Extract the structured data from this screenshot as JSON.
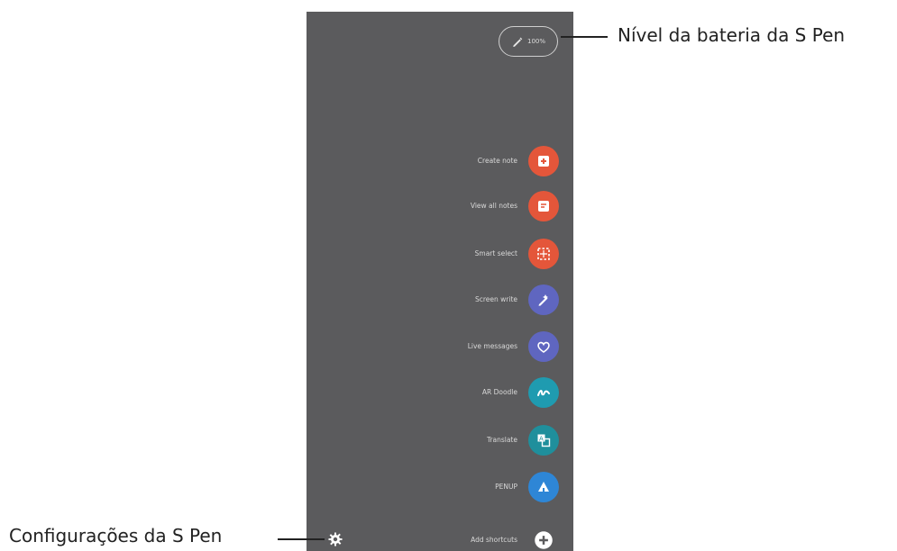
{
  "callouts": {
    "battery_label": "Nível da bateria da S Pen",
    "settings_label": "Configurações da S Pen"
  },
  "battery": {
    "level_text": "100%"
  },
  "shortcuts": [
    {
      "label": "Create note",
      "icon": "note-plus-icon",
      "color": "#e4563a"
    },
    {
      "label": "View all notes",
      "icon": "notes-icon",
      "color": "#e4563a"
    },
    {
      "label": "Smart select",
      "icon": "smart-select-icon",
      "color": "#e4563a"
    },
    {
      "label": "Screen write",
      "icon": "screen-write-icon",
      "color": "#5f66c0"
    },
    {
      "label": "Live messages",
      "icon": "heart-icon",
      "color": "#5f66c0"
    },
    {
      "label": "AR Doodle",
      "icon": "doodle-icon",
      "color": "#1f9bb0"
    },
    {
      "label": "Translate",
      "icon": "translate-icon",
      "color": "#1f8f9c"
    },
    {
      "label": "PENUP",
      "icon": "penup-icon",
      "color": "#2e86d6"
    },
    {
      "label": "Add shortcuts",
      "icon": "plus-icon",
      "color": "#ffffff"
    }
  ]
}
